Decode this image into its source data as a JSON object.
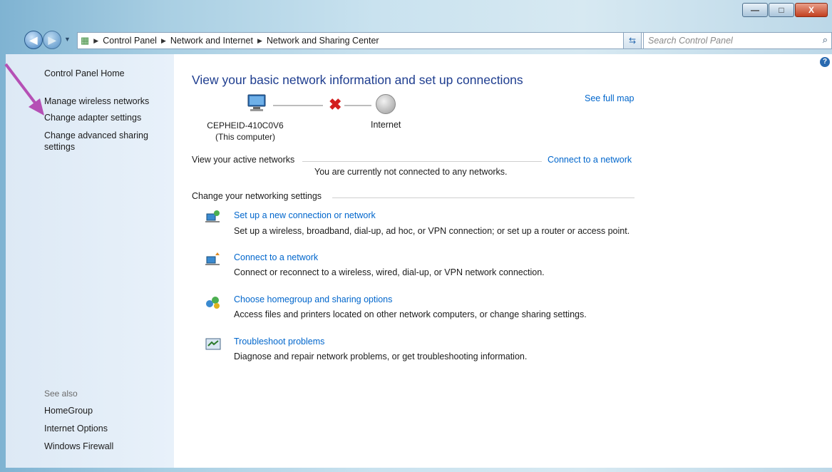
{
  "window": {
    "buttons": {
      "minimize": "—",
      "maximize": "□",
      "close": "X"
    }
  },
  "nav": {
    "back": "◀",
    "forward": "▶",
    "breadcrumbs": [
      "Control Panel",
      "Network and Internet",
      "Network and Sharing Center"
    ],
    "separator": "▶",
    "search_placeholder": "Search Control Panel"
  },
  "sidebar": {
    "home": "Control Panel Home",
    "links": [
      "Manage wireless networks",
      "Change adapter settings",
      "Change advanced sharing settings"
    ],
    "see_also_label": "See also",
    "see_also": [
      "HomeGroup",
      "Internet Options",
      "Windows Firewall"
    ]
  },
  "main": {
    "title": "View your basic network information and set up connections",
    "see_full_map": "See full map",
    "computer_name": "CEPHEID-410C0V6",
    "computer_sub": "(This computer)",
    "internet_label": "Internet",
    "active_networks_label": "View your active networks",
    "connect_link": "Connect to a network",
    "not_connected": "You are currently not connected to any networks.",
    "change_settings_label": "Change your networking settings",
    "tasks": [
      {
        "title": "Set up a new connection or network",
        "desc": "Set up a wireless, broadband, dial-up, ad hoc, or VPN connection; or set up a router or access point."
      },
      {
        "title": "Connect to a network",
        "desc": "Connect or reconnect to a wireless, wired, dial-up, or VPN network connection."
      },
      {
        "title": "Choose homegroup and sharing options",
        "desc": "Access files and printers located on other network computers, or change sharing settings."
      },
      {
        "title": "Troubleshoot problems",
        "desc": "Diagnose and repair network problems, or get troubleshooting information."
      }
    ]
  }
}
